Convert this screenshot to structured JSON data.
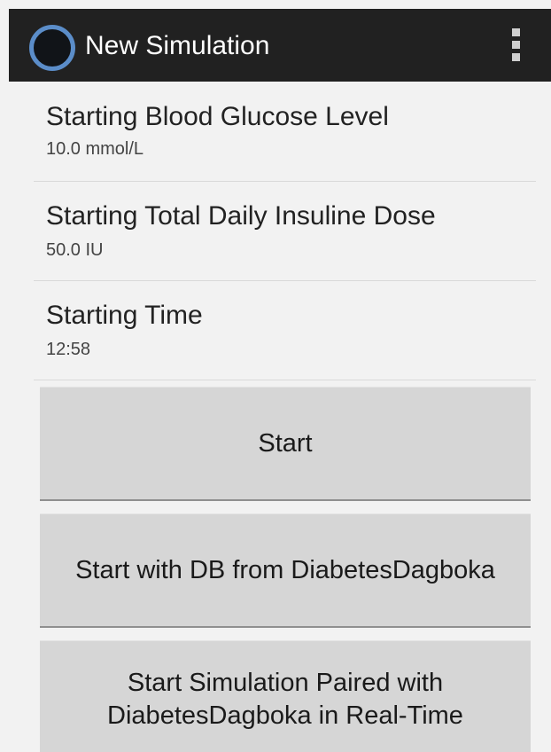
{
  "action_bar": {
    "title": "New Simulation",
    "icon": "circle-app-icon",
    "overflow_icon": "overflow-menu-icon"
  },
  "preferences": [
    {
      "title": "Starting Blood Glucose Level",
      "summary": "10.0 mmol/L"
    },
    {
      "title": "Starting Total Daily Insuline Dose",
      "summary": "50.0 IU"
    },
    {
      "title": "Starting Time",
      "summary": "12:58"
    }
  ],
  "buttons": {
    "start": "Start",
    "start_with_db": "Start with DB from DiabetesDagboka",
    "start_paired_line1": "Start Simulation Paired with",
    "start_paired_line2": "DiabetesDagboka in Real-Time"
  },
  "colors": {
    "action_bar": "#212121",
    "background": "#f2f2f2",
    "button": "#d6d6d6",
    "icon_ring": "#5b8dc9"
  }
}
